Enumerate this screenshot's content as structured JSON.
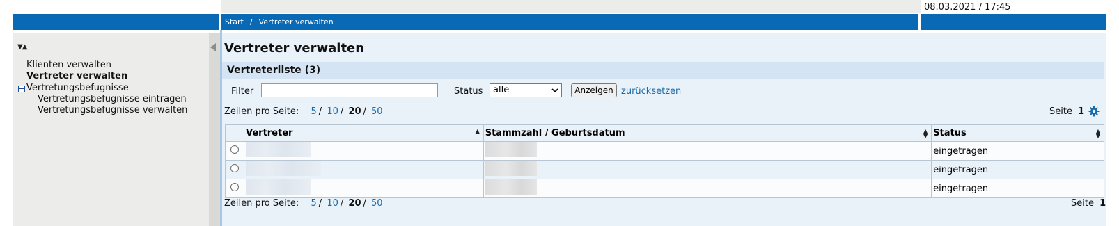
{
  "header": {
    "datetime": "08.03.2021 / 17:45",
    "breadcrumb": [
      "Start",
      "/",
      "Vertreter verwalten"
    ]
  },
  "sidebar": {
    "tree_toggle_label": "▼▲",
    "items": [
      {
        "label": "Klienten verwalten"
      },
      {
        "label": "Vertreter verwalten"
      },
      {
        "label": "Vertretungsbefugnisse"
      },
      {
        "label": "Vertretungsbefugnisse eintragen"
      },
      {
        "label": "Vertretungsbefugnisse verwalten"
      }
    ]
  },
  "main": {
    "title": "Vertreter verwalten",
    "section_title": "Vertreterliste (3)",
    "filter": {
      "label": "Filter",
      "value": "",
      "placeholder": ""
    },
    "status": {
      "label": "Status",
      "selected": "alle"
    },
    "show_button": "Anzeigen",
    "reset_link": "zurücksetzen",
    "pager": {
      "label": "Zeilen pro Seite:",
      "options": [
        "5",
        "10",
        "20",
        "50"
      ],
      "current": "20",
      "sep": "/",
      "page_label": "Seite",
      "page_number": "1"
    },
    "table": {
      "columns": [
        "Vertreter",
        "Stammzahl / Geburtsdatum",
        "Status"
      ],
      "rows": [
        {
          "status": "eingetragen"
        },
        {
          "status": "eingetragen"
        },
        {
          "status": "eingetragen"
        }
      ]
    }
  },
  "colors": {
    "brand_blue": "#0a69b4",
    "link": "#1a6aa8",
    "section_bg": "#d5e4f5"
  },
  "icons": [
    "tree-toggle-icon",
    "collapse-sidebar-icon",
    "minus-box-icon",
    "gear-icon",
    "sort-icon",
    "radio-icon"
  ]
}
